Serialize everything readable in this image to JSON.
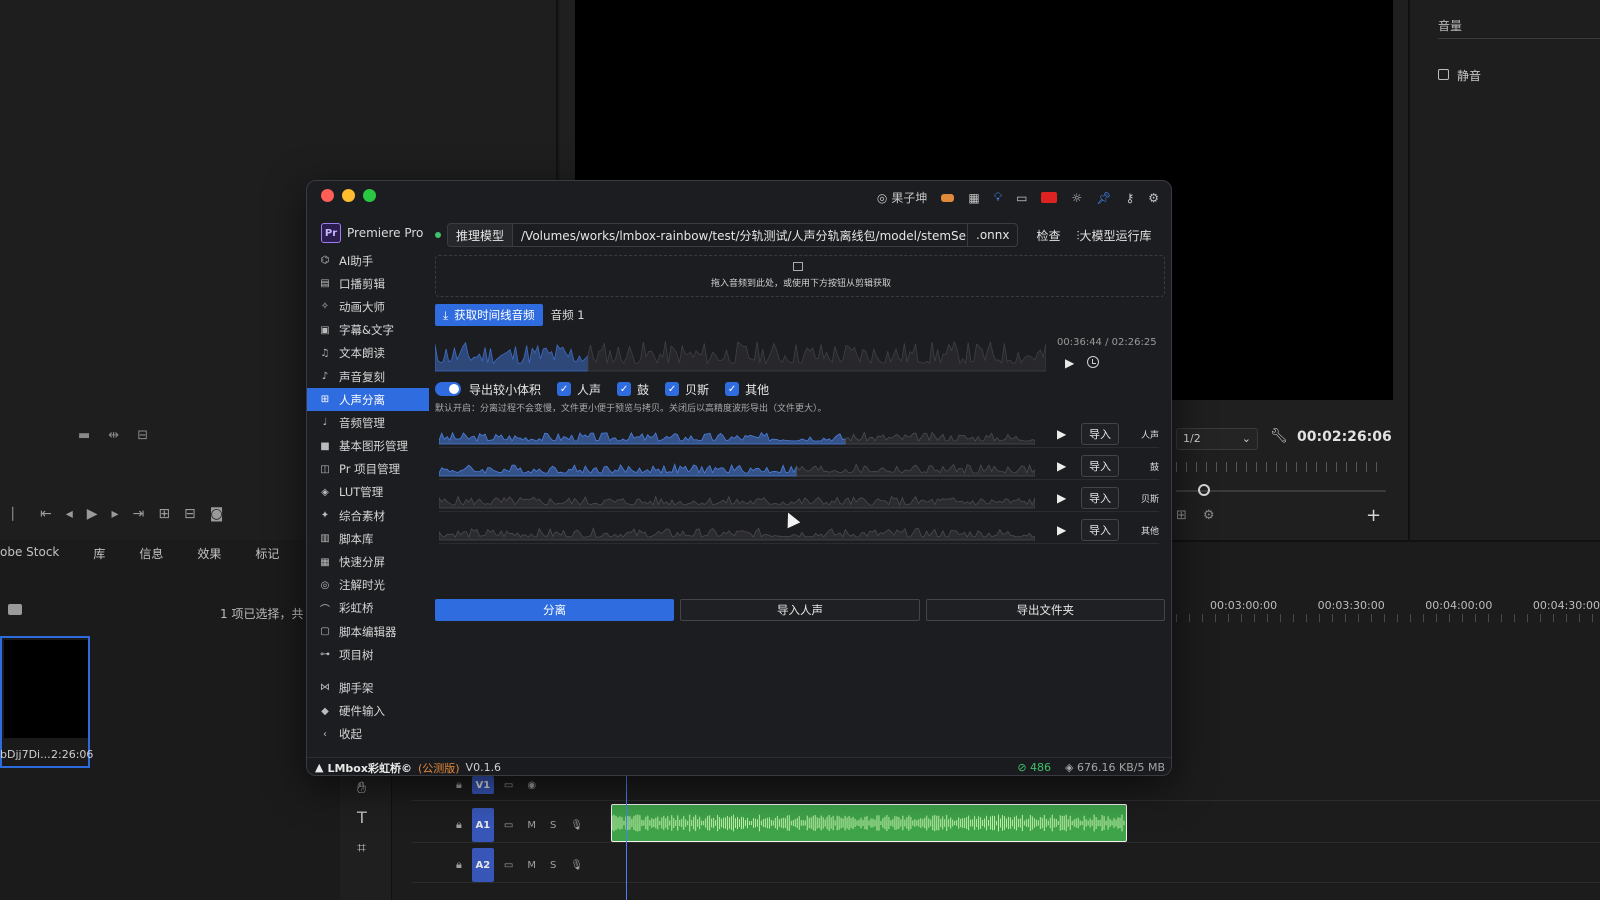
{
  "premiere": {
    "volume_label": "音量",
    "mute_label": "静音",
    "panel_tabs": [
      "obe Stock",
      "库",
      "信息",
      "效果",
      "标记"
    ],
    "project_status": "1 项已选择，共 2",
    "clip": {
      "name": "bDjj7Di...",
      "duration": "2:26:06"
    },
    "monitor_fraction": "1/2",
    "monitor_timecode": "00:02:26:06",
    "ruler_times": [
      "00:03:00:00",
      "00:03:30:00",
      "00:04:00:00",
      "00:04:30:00"
    ],
    "tracks": [
      {
        "label": "V1"
      },
      {
        "label": "A1",
        "m": "M",
        "s": "S"
      },
      {
        "label": "A2",
        "m": "M",
        "s": "S"
      }
    ]
  },
  "window": {
    "title_icons": [
      "user-icon",
      "badge-icon",
      "store-icon",
      "bulb-icon",
      "chat-icon",
      "flag-icon",
      "sun-icon",
      "pin-icon",
      "key-icon",
      "settings-icon"
    ],
    "username": "果子坤",
    "brand": {
      "logo": "Pr",
      "name": "Premiere Pro"
    },
    "nav": [
      {
        "icon": "assistant-icon",
        "label": "AI助手"
      },
      {
        "icon": "broadcast-icon",
        "label": "口播剪辑"
      },
      {
        "icon": "animation-icon",
        "label": "动画大师"
      },
      {
        "icon": "subtitle-icon",
        "label": "字幕&文字"
      },
      {
        "icon": "tts-icon",
        "label": "文本朗读"
      },
      {
        "icon": "voice-clone-icon",
        "label": "声音复刻"
      },
      {
        "icon": "separation-icon",
        "label": "人声分离",
        "active": true
      },
      {
        "icon": "audio-icon",
        "label": "音频管理"
      },
      {
        "icon": "graphics-icon",
        "label": "基本图形管理"
      },
      {
        "icon": "project-icon",
        "label": "Pr 项目管理"
      },
      {
        "icon": "lut-icon",
        "label": "LUT管理"
      },
      {
        "icon": "assets-icon",
        "label": "综合素材"
      },
      {
        "icon": "script-icon",
        "label": "脚本库"
      },
      {
        "icon": "split-icon",
        "label": "快速分屏"
      },
      {
        "icon": "time-icon",
        "label": "注解时光"
      },
      {
        "icon": "rainbow-icon",
        "label": "彩虹桥"
      },
      {
        "icon": "editor-icon",
        "label": "脚本编辑器"
      },
      {
        "icon": "tree-icon",
        "label": "项目树"
      }
    ],
    "nav_bottom": [
      {
        "icon": "scaffold-icon",
        "label": "脚手架"
      },
      {
        "icon": "hardware-icon",
        "label": "硬件输入"
      },
      {
        "icon": "collapse-icon",
        "label": "收起"
      }
    ],
    "model": {
      "label": "推理模型",
      "path": "/Volumes/works/lmbox-rainbow/test/分轨测试/人声分轨离线包/model/stemSepa...",
      "ext": ".onnx",
      "check": "检查",
      "lib": "大模型运行库"
    },
    "drop_text": "拖入音频到此处，或使用下方按钮从剪辑获取",
    "fetch_button": "获取时间线音频",
    "audio_label": "音频 1",
    "wave_time": "00:36:44 / 02:26:25",
    "options": {
      "toggle_label": "导出较小体积",
      "checks": [
        "人声",
        "鼓",
        "贝斯",
        "其他"
      ],
      "hint": "默认开启：分离过程不会变慢，文件更小便于预览与拷贝。关闭后以高精度波形导出（文件更大）。"
    },
    "stems": [
      {
        "name": "人声",
        "import": "导入",
        "progress": 0.68
      },
      {
        "name": "鼓",
        "import": "导入",
        "progress": 0.6
      },
      {
        "name": "贝斯",
        "import": "导入",
        "progress": 0
      },
      {
        "name": "其他",
        "import": "导入",
        "progress": 0
      }
    ],
    "actions": {
      "separate": "分离",
      "import_vocal": "导入人声",
      "export_folder": "导出文件夹"
    },
    "status": {
      "brand": "LMbox彩虹桥©",
      "beta": "(公测版)",
      "version": "V0.1.6",
      "count": "486",
      "speed": "676.16 KB/5 MB"
    },
    "colors": {
      "accent": "#2f6ce0",
      "success": "#3fc26a"
    },
    "main_wave_progress": 0.25
  }
}
